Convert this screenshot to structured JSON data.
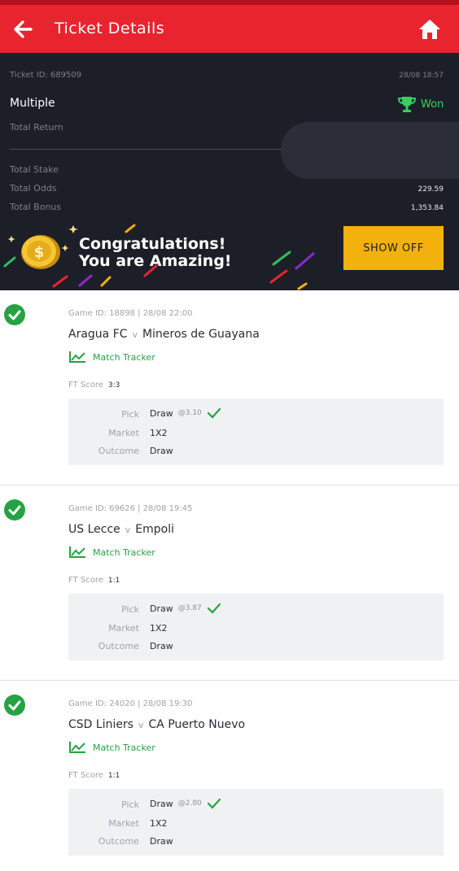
{
  "header": {
    "title": "Ticket Details",
    "back_icon": "arrow-left-icon",
    "home_icon": "home-icon"
  },
  "summary": {
    "ticket_id_label": "Ticket ID: 689509",
    "date": "28/08 18:57",
    "bet_type": "Multiple",
    "status": "Won",
    "status_icon": "trophy-icon",
    "total_return_label": "Total Return",
    "total_stake_label": "Total Stake",
    "total_odds_label": "Total Odds",
    "total_odds_value": "229.59",
    "total_bonus_label": "Total Bonus",
    "total_bonus_value": "1,353.84"
  },
  "banner": {
    "line1": "Congratulations!",
    "line2": "You are Amazing!",
    "button": "SHOW OFF",
    "coin_icon": "dollar-coin-icon"
  },
  "games": [
    {
      "meta": "Game ID: 18898 | 28/08 22:00",
      "home": "Aragua FC",
      "sep": "v",
      "away": "Mineros de Guayana",
      "tracker_label": "Match Tracker",
      "ft_label": "FT Score",
      "ft_value": "3:3",
      "pick_label": "Pick",
      "pick_value": "Draw",
      "pick_odds": "@3.10",
      "market_label": "Market",
      "market_value": "1X2",
      "outcome_label": "Outcome",
      "outcome_value": "Draw"
    },
    {
      "meta": "Game ID: 69626 | 28/08 19:45",
      "home": "US Lecce",
      "sep": "v",
      "away": "Empoli",
      "tracker_label": "Match Tracker",
      "ft_label": "FT Score",
      "ft_value": "1:1",
      "pick_label": "Pick",
      "pick_value": "Draw",
      "pick_odds": "@3.87",
      "market_label": "Market",
      "market_value": "1X2",
      "outcome_label": "Outcome",
      "outcome_value": "Draw"
    },
    {
      "meta": "Game ID: 24020 | 28/08 19:30",
      "home": "CSD Liniers",
      "sep": "v",
      "away": "CA Puerto Nuevo",
      "tracker_label": "Match Tracker",
      "ft_label": "FT Score",
      "ft_value": "1:1",
      "pick_label": "Pick",
      "pick_value": "Draw",
      "pick_odds": "@2.80",
      "market_label": "Market",
      "market_value": "1X2",
      "outcome_label": "Outcome",
      "outcome_value": "Draw"
    }
  ],
  "colors": {
    "header": "#e8242f",
    "dark_panel": "#1d1f28",
    "win_green": "#26a243",
    "button_yellow": "#f2b10c"
  }
}
